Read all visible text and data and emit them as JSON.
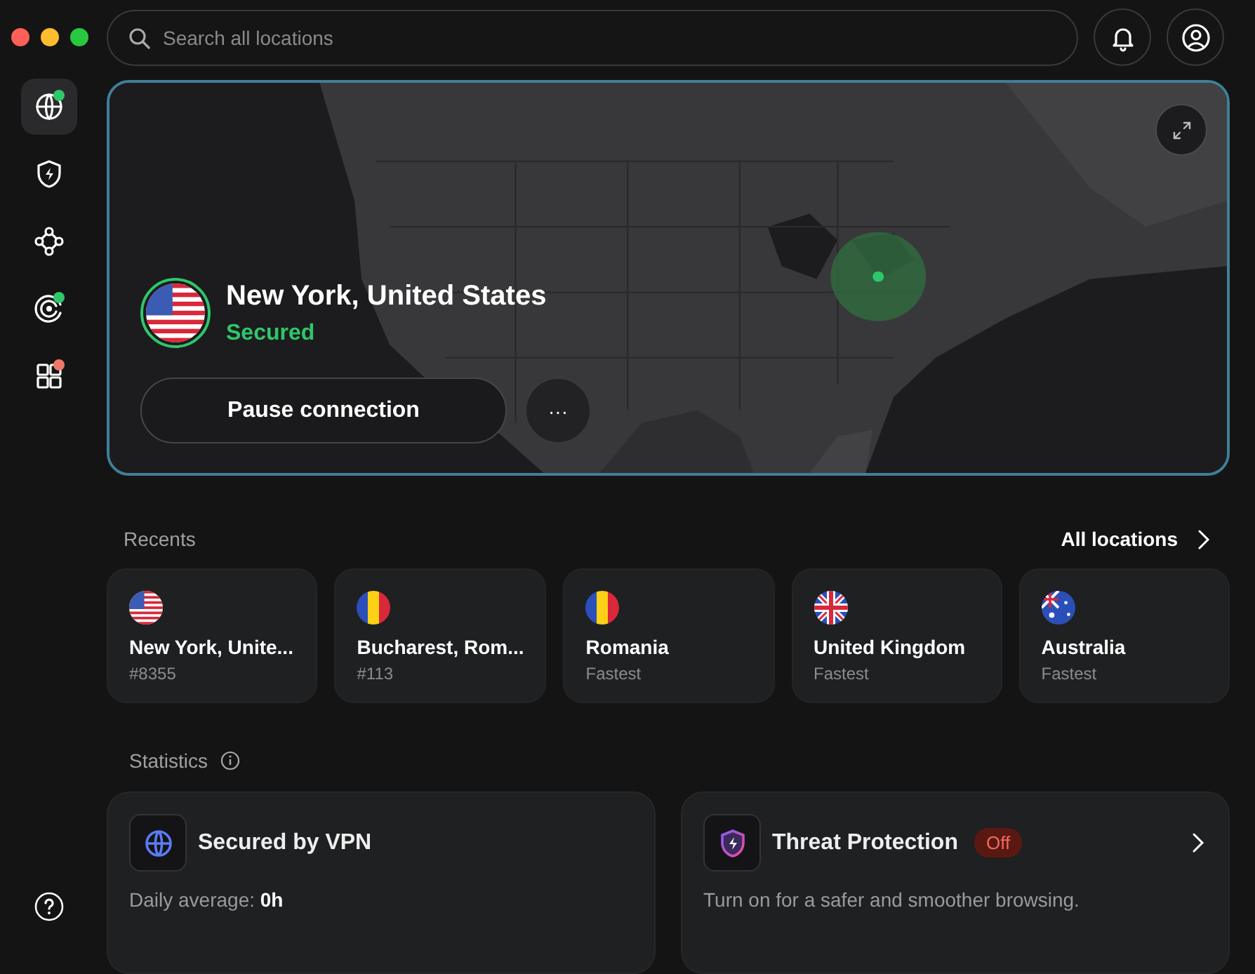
{
  "window": {
    "traffic_lights": [
      {
        "kind": "close"
      },
      {
        "kind": "minimize"
      },
      {
        "kind": "zoom"
      }
    ]
  },
  "search": {
    "placeholder": "Search all locations"
  },
  "sidebar": {
    "items": [
      {
        "kind": "globe",
        "selected": true,
        "color": "#2fc76b"
      },
      {
        "kind": "shield",
        "selected": false
      },
      {
        "kind": "nodes",
        "selected": false
      },
      {
        "kind": "radar",
        "selected": false,
        "color": "#2fc76b"
      },
      {
        "kind": "apps",
        "selected": false,
        "color": "#f0786a"
      }
    ]
  },
  "connection": {
    "flag": {
      "kind": "us"
    },
    "location": "New York, United States",
    "status": "Secured",
    "pause_button": "Pause connection",
    "more_button": "···"
  },
  "recents": {
    "title": "Recents",
    "all_link": "All locations",
    "items": [
      {
        "flag": {
          "kind": "us"
        },
        "name": "New York, Unite...",
        "detail": "#8355"
      },
      {
        "flag": {
          "kind": "ro"
        },
        "name": "Bucharest, Rom...",
        "detail": "#113"
      },
      {
        "flag": {
          "kind": "ro"
        },
        "name": "Romania",
        "detail": "Fastest"
      },
      {
        "flag": {
          "kind": "uk"
        },
        "name": "United Kingdom",
        "detail": "Fastest"
      },
      {
        "flag": {
          "kind": "au"
        },
        "name": "Australia",
        "detail": "Fastest"
      }
    ]
  },
  "statistics": {
    "title": "Statistics",
    "cards": [
      {
        "kind": "vpn",
        "title": "Secured by VPN",
        "text": "Daily average: **0h**"
      },
      {
        "kind": "threat",
        "title": "Threat Protection",
        "badge": "Off",
        "text": "Turn on for a safer and smoother browsing."
      }
    ]
  }
}
